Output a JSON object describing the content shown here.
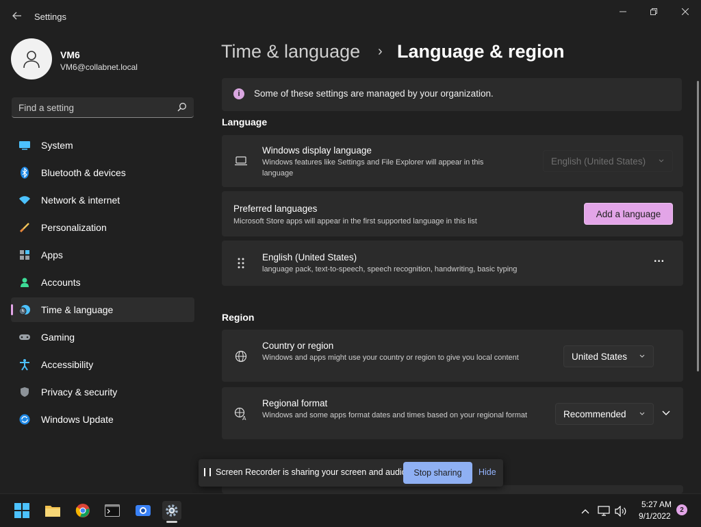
{
  "window": {
    "title": "Settings",
    "back_icon": "arrow-left-icon",
    "controls": [
      "minimize-icon",
      "restore-icon",
      "close-icon"
    ]
  },
  "profile": {
    "name": "VM6",
    "email": "VM6@collabnet.local"
  },
  "search": {
    "placeholder": "Find a setting"
  },
  "sidebar": {
    "items": [
      {
        "label": "System",
        "icon": "system-icon",
        "active": false
      },
      {
        "label": "Bluetooth & devices",
        "icon": "bluetooth-icon",
        "active": false
      },
      {
        "label": "Network & internet",
        "icon": "wifi-icon",
        "active": false
      },
      {
        "label": "Personalization",
        "icon": "brush-icon",
        "active": false
      },
      {
        "label": "Apps",
        "icon": "apps-icon",
        "active": false
      },
      {
        "label": "Accounts",
        "icon": "accounts-icon",
        "active": false
      },
      {
        "label": "Time & language",
        "icon": "time-language-icon",
        "active": true
      },
      {
        "label": "Gaming",
        "icon": "gamepad-icon",
        "active": false
      },
      {
        "label": "Accessibility",
        "icon": "accessibility-icon",
        "active": false
      },
      {
        "label": "Privacy & security",
        "icon": "shield-icon",
        "active": false
      },
      {
        "label": "Windows Update",
        "icon": "update-icon",
        "active": false
      }
    ]
  },
  "breadcrumb": {
    "parent": "Time & language",
    "separator": "›",
    "current": "Language & region"
  },
  "banner": {
    "text": "Some of these settings are managed by your organization."
  },
  "language": {
    "section_title": "Language",
    "display_language": {
      "title": "Windows display language",
      "description": "Windows features like Settings and File Explorer will appear in this language",
      "value": "English (United States)"
    },
    "preferred": {
      "title": "Preferred languages",
      "description": "Microsoft Store apps will appear in the first supported language in this list",
      "button": "Add a language"
    },
    "installed": {
      "title": "English (United States)",
      "description": "language pack, text-to-speech, speech recognition, handwriting, basic typing",
      "more": "···"
    }
  },
  "region": {
    "section_title": "Region",
    "country": {
      "title": "Country or region",
      "description": "Windows and apps might use your country or region to give you local content",
      "value": "United States"
    },
    "format": {
      "title": "Regional format",
      "description": "Windows and some apps format dates and times based on your regional format",
      "value": "Recommended"
    }
  },
  "recorder": {
    "text": "Screen Recorder is sharing your screen and audio.",
    "stop": "Stop sharing",
    "hide": "Hide"
  },
  "taskbar": {
    "time": "5:27 AM",
    "date": "9/1/2022",
    "notifications": "2"
  },
  "colors": {
    "accent": "#e3a5e8",
    "background": "#202020",
    "card": "#2b2b2b",
    "recorder_button": "#8fb0f3"
  }
}
